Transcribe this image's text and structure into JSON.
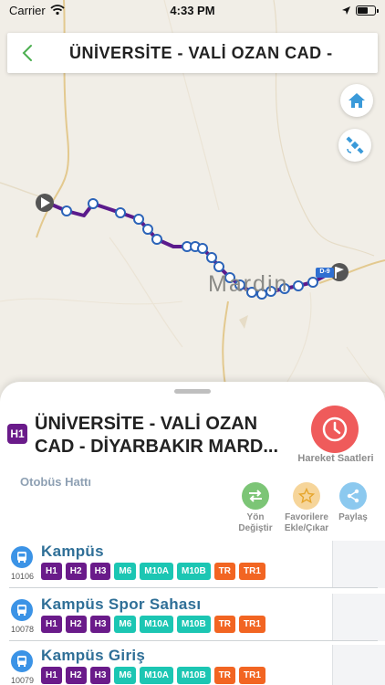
{
  "status_bar": {
    "carrier": "Carrier",
    "time": "4:33 PM"
  },
  "header": {
    "title": "ÜNİVERSİTE - VALİ OZAN CAD -"
  },
  "map": {
    "city_label": "Mardin",
    "road_badge": "D-9"
  },
  "route": {
    "badge": "H1",
    "title_line1": "ÜNİVERSİTE - VALİ OZAN",
    "title_line2": "CAD - DİYARBAKIR MARD...",
    "type": "Otobüs Hattı",
    "schedule_label": "Hareket Saatleri"
  },
  "actions": [
    {
      "label1": "Yön",
      "label2": "Değiştir",
      "color": "#7cc576"
    },
    {
      "label1": "Favorilere",
      "label2": "Ekle/Çıkar",
      "color": "#f6d59a"
    },
    {
      "label1": "Paylaş",
      "label2": "",
      "color": "#8cc9ef"
    }
  ],
  "chip_colors": {
    "purple": "#6a1b8a",
    "teal": "#1cc6b3",
    "orange": "#f26522"
  },
  "stops": [
    {
      "name": "Kampüs",
      "code": "10106",
      "lines": [
        "H1",
        "H2",
        "H3",
        "M6",
        "M10A",
        "M10B",
        "TR",
        "TR1"
      ]
    },
    {
      "name": "Kampüs Spor Sahası",
      "code": "10078",
      "lines": [
        "H1",
        "H2",
        "H3",
        "M6",
        "M10A",
        "M10B",
        "TR",
        "TR1"
      ]
    },
    {
      "name": "Kampüs Giriş",
      "code": "10079",
      "lines": [
        "H1",
        "H2",
        "H3",
        "M6",
        "M10A",
        "M10B",
        "TR",
        "TR1"
      ]
    }
  ]
}
